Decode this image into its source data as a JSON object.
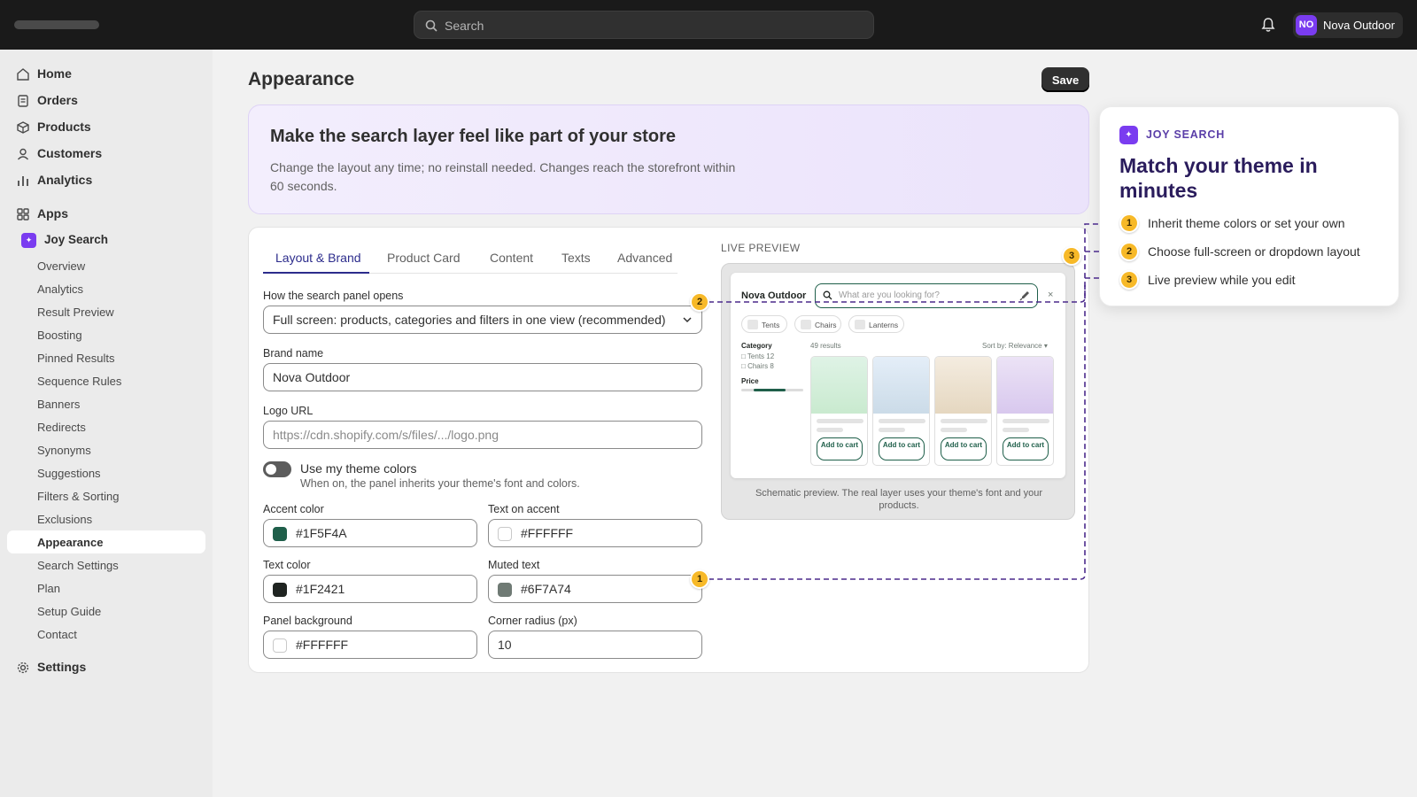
{
  "topbar": {
    "search_placeholder": "Search",
    "store_initials": "NO",
    "store_name": "Nova Outdoor"
  },
  "sidebar": {
    "main_items": [
      {
        "label": "Home",
        "icon": "home-icon"
      },
      {
        "label": "Orders",
        "icon": "orders-icon"
      },
      {
        "label": "Products",
        "icon": "products-icon"
      },
      {
        "label": "Customers",
        "icon": "customers-icon"
      },
      {
        "label": "Analytics",
        "icon": "analytics-icon"
      }
    ],
    "apps_label": "Apps",
    "app_name": "Joy Search",
    "app_items": [
      "Overview",
      "Analytics",
      "Result Preview",
      "Boosting",
      "Pinned Results",
      "Sequence Rules",
      "Banners",
      "Redirects",
      "Synonyms",
      "Suggestions",
      "Filters & Sorting",
      "Exclusions",
      "Appearance",
      "Search Settings",
      "Plan",
      "Setup Guide",
      "Contact"
    ],
    "active_item": "Appearance",
    "settings_label": "Settings"
  },
  "page": {
    "title": "Appearance",
    "save_label": "Save"
  },
  "hero": {
    "title": "Make the search layer feel like part of your store",
    "description": "Change the layout any time; no reinstall needed. Changes reach the storefront within 60 seconds."
  },
  "tabs": [
    "Layout & Brand",
    "Product Card",
    "Content",
    "Texts",
    "Advanced"
  ],
  "active_tab": "Layout & Brand",
  "form": {
    "panel_open_label": "How the search panel opens",
    "panel_open_value": "Full screen: products, categories and filters in one view (recommended)",
    "brand_label": "Brand name",
    "brand_value": "Nova Outdoor",
    "logo_label": "Logo URL",
    "logo_placeholder": "https://cdn.shopify.com/s/files/.../logo.png",
    "theme_toggle_label": "Use my theme colors",
    "theme_toggle_help": "When on, the panel inherits your theme's font and colors.",
    "theme_toggle_on": false,
    "accent_label": "Accent color",
    "accent_value": "#1F5F4A",
    "text_on_accent_label": "Text on accent",
    "text_on_accent_value": "#FFFFFF",
    "text_color_label": "Text color",
    "text_color_value": "#1F2421",
    "muted_label": "Muted text",
    "muted_value": "#6F7A74",
    "panel_bg_label": "Panel background",
    "panel_bg_value": "#FFFFFF",
    "radius_label": "Corner radius (px)",
    "radius_value": "10"
  },
  "preview": {
    "label": "LIVE PREVIEW",
    "brand": "Nova Outdoor",
    "search_placeholder": "What are you looking for?",
    "close_glyph": "×",
    "chips": [
      "Tents",
      "Chairs",
      "Lanterns"
    ],
    "category_heading": "Category",
    "category_options": [
      "Tents 12",
      "Chairs 8"
    ],
    "price_heading": "Price",
    "results_count": "49 results",
    "sort_label": "Sort by: Relevance ▾",
    "add_to_cart": "Add to cart",
    "caption": "Schematic preview. The real layer uses your theme's font and your products."
  },
  "callout": {
    "brand": "JOY SEARCH",
    "title": "Match your theme in minutes",
    "steps": [
      {
        "num": "1",
        "text": "Inherit theme colors or set your own"
      },
      {
        "num": "2",
        "text": "Choose full-screen or dropdown layout"
      },
      {
        "num": "3",
        "text": "Live preview while you edit"
      }
    ]
  },
  "badges": {
    "one": "1",
    "two": "2",
    "three": "3"
  },
  "colors": {
    "accent": "#1F5F4A",
    "text": "#1F2421",
    "muted": "#6F7A74",
    "brand_purple": "#7A3CF0",
    "badge": "#F7B928"
  }
}
